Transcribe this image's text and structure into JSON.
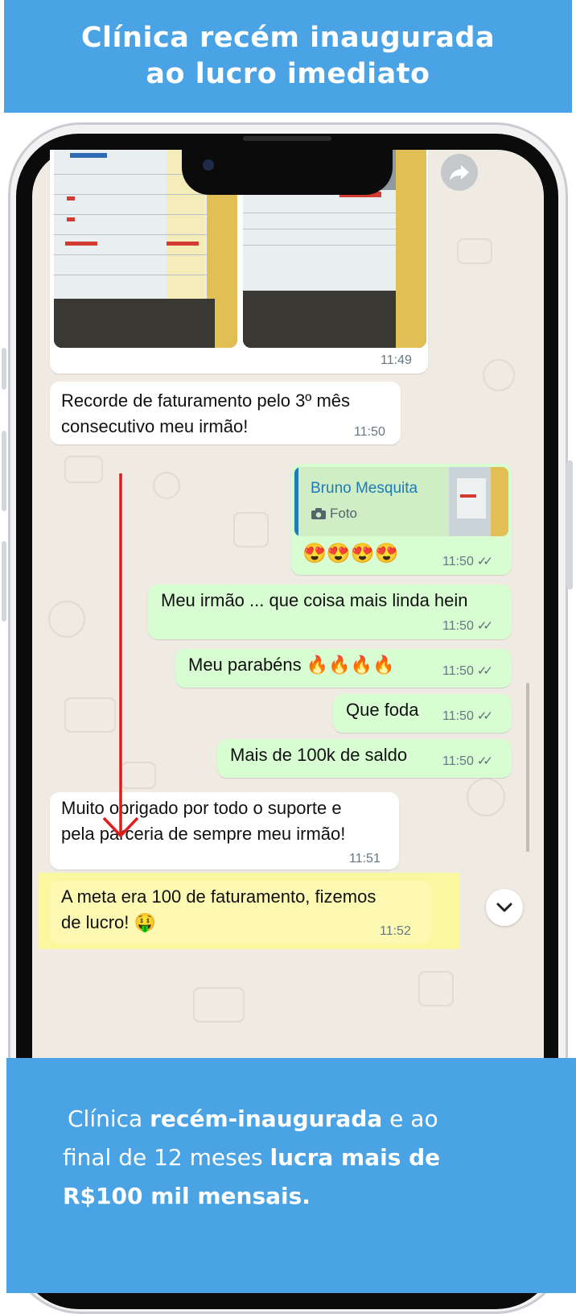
{
  "header": {
    "line1": "Clínica recém inaugurada",
    "line2": "ao lucro imediato"
  },
  "chat": {
    "photo_time": "11:49",
    "messages": [
      {
        "line1": "Recorde de faturamento pelo 3º mês",
        "line2": "consecutivo meu irmão!",
        "time": "11:50",
        "direction": "incoming"
      },
      {
        "reply_author": "Bruno Mesquita",
        "reply_type": "Foto",
        "text": "😍😍😍😍",
        "time": "11:50",
        "direction": "outgoing"
      },
      {
        "text": "Meu irmão ... que coisa mais linda hein",
        "time": "11:50",
        "direction": "outgoing"
      },
      {
        "text": "Meu parabéns 🔥🔥🔥🔥",
        "time": "11:50",
        "direction": "outgoing"
      },
      {
        "text": "Que foda",
        "time": "11:50",
        "direction": "outgoing"
      },
      {
        "text": "Mais de 100k de saldo",
        "time": "11:50",
        "direction": "outgoing"
      },
      {
        "line1": "Muito obrigado por todo o suporte e",
        "line2": "pela parceria de sempre meu irmão!",
        "time": "11:51",
        "direction": "incoming"
      },
      {
        "line1": "A meta era 100 de faturamento, fizemos",
        "line2": "de lucro! 🤑",
        "time": "11:52",
        "direction": "incoming"
      }
    ]
  },
  "footer": {
    "l1_a": "Clínica ",
    "l1_b": "recém-inaugurada",
    "l1_c": " e ao",
    "l2_a": "final de 12 meses ",
    "l2_b": "lucra mais de",
    "l3": "R$100 mil mensais."
  },
  "colors": {
    "banner": "#4aa3e4",
    "chat_bg": "#efeae2",
    "outgoing_bubble": "#d9fdd3",
    "incoming_bubble": "#ffffff",
    "highlight": "#fbf7a1",
    "annotation_arrow": "#e01b1b",
    "reply_author": "#1f7ab5"
  },
  "icons": [
    "forward-icon",
    "camera-icon",
    "double-check-icon",
    "chevron-down-icon"
  ]
}
